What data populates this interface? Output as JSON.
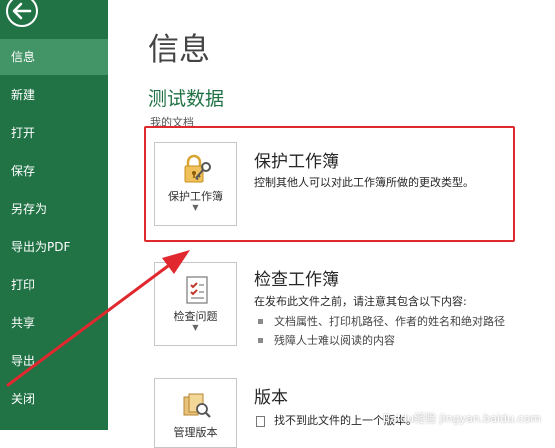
{
  "sidebar": {
    "items": [
      {
        "label": "信息",
        "active": true
      },
      {
        "label": "新建"
      },
      {
        "label": "打开"
      },
      {
        "label": "保存"
      },
      {
        "label": "另存为"
      },
      {
        "label": "导出为PDF"
      },
      {
        "label": "打印"
      },
      {
        "label": "共享"
      },
      {
        "label": "导出"
      },
      {
        "label": "关闭"
      }
    ]
  },
  "main": {
    "title": "信息",
    "doc_name": "测试数据",
    "doc_path": "我的文档",
    "protect": {
      "tile_label": "保护工作簿",
      "title": "保护工作簿",
      "description": "控制其他人可以对此工作簿所做的更改类型。"
    },
    "inspect": {
      "tile_label": "检查问题",
      "title": "检查工作簿",
      "description": "在发布此文件之前，请注意其包含以下内容:",
      "bullets": [
        "文档属性、打印机路径、作者的姓名和绝对路径",
        "残障人士难以阅读的内容"
      ]
    },
    "versions": {
      "tile_label": "管理版本",
      "title": "版本",
      "file_text": "找不到此文件的上一个版本。"
    }
  },
  "watermark": "Baidu经验 jingyan.baidu.com",
  "colors": {
    "sidebar": "#217346",
    "sidebar_active": "#439467",
    "highlight": "#e0282e"
  },
  "icons": {
    "back": "back-arrow-icon",
    "protect": "lock-key-icon",
    "inspect": "checklist-icon",
    "versions": "version-docs-icon"
  }
}
